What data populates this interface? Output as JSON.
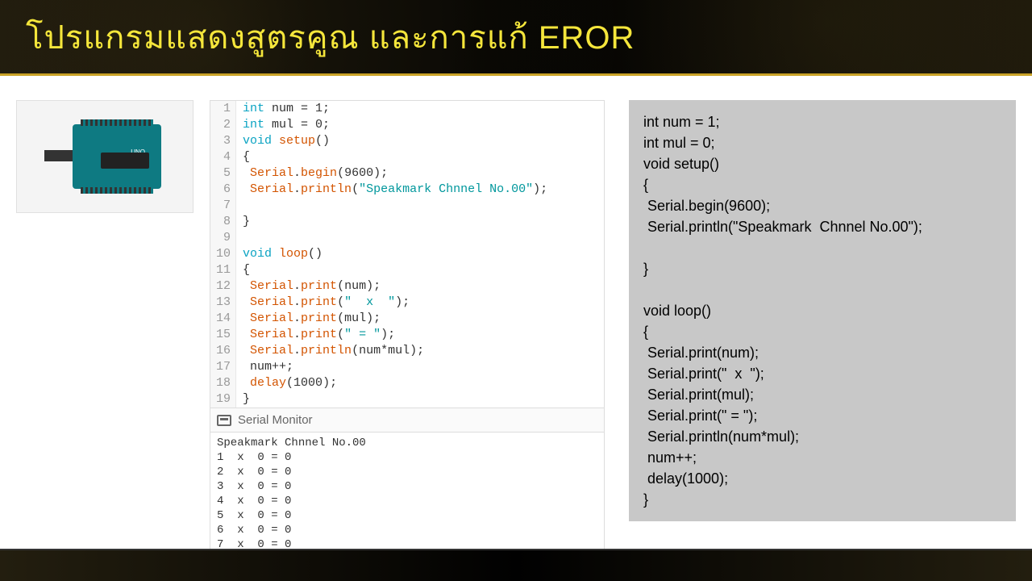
{
  "title": "โปรแกรมแสดงสูตรคูณ และการแก้ EROR",
  "arduino_label": "UNO",
  "editor": {
    "lines": [
      {
        "n": "1",
        "segs": [
          {
            "t": "int",
            "c": "kw"
          },
          {
            "t": " num = "
          },
          {
            "t": "1",
            "c": "num"
          },
          {
            "t": ";"
          }
        ]
      },
      {
        "n": "2",
        "segs": [
          {
            "t": "int",
            "c": "kw"
          },
          {
            "t": " mul = "
          },
          {
            "t": "0",
            "c": "num"
          },
          {
            "t": ";"
          }
        ]
      },
      {
        "n": "3",
        "segs": [
          {
            "t": "void",
            "c": "kw"
          },
          {
            "t": " "
          },
          {
            "t": "setup",
            "c": "fn"
          },
          {
            "t": "()"
          }
        ]
      },
      {
        "n": "4",
        "segs": [
          {
            "t": "{"
          }
        ]
      },
      {
        "n": "5",
        "segs": [
          {
            "t": " "
          },
          {
            "t": "Serial",
            "c": "fn"
          },
          {
            "t": "."
          },
          {
            "t": "begin",
            "c": "fn"
          },
          {
            "t": "("
          },
          {
            "t": "9600",
            "c": "num"
          },
          {
            "t": ");"
          }
        ]
      },
      {
        "n": "6",
        "segs": [
          {
            "t": " "
          },
          {
            "t": "Serial",
            "c": "fn"
          },
          {
            "t": "."
          },
          {
            "t": "println",
            "c": "fn"
          },
          {
            "t": "("
          },
          {
            "t": "\"Speakmark Chnnel No.00\"",
            "c": "str"
          },
          {
            "t": ");"
          }
        ]
      },
      {
        "n": "7",
        "segs": [
          {
            "t": " "
          }
        ]
      },
      {
        "n": "8",
        "segs": [
          {
            "t": "}"
          }
        ]
      },
      {
        "n": "9",
        "segs": [
          {
            "t": ""
          }
        ]
      },
      {
        "n": "10",
        "segs": [
          {
            "t": "void",
            "c": "kw"
          },
          {
            "t": " "
          },
          {
            "t": "loop",
            "c": "fn"
          },
          {
            "t": "()"
          }
        ]
      },
      {
        "n": "11",
        "segs": [
          {
            "t": "{"
          }
        ]
      },
      {
        "n": "12",
        "segs": [
          {
            "t": " "
          },
          {
            "t": "Serial",
            "c": "fn"
          },
          {
            "t": "."
          },
          {
            "t": "print",
            "c": "fn"
          },
          {
            "t": "(num);"
          }
        ]
      },
      {
        "n": "13",
        "segs": [
          {
            "t": " "
          },
          {
            "t": "Serial",
            "c": "fn"
          },
          {
            "t": "."
          },
          {
            "t": "print",
            "c": "fn"
          },
          {
            "t": "("
          },
          {
            "t": "\"  x  \"",
            "c": "str"
          },
          {
            "t": ");"
          }
        ]
      },
      {
        "n": "14",
        "segs": [
          {
            "t": " "
          },
          {
            "t": "Serial",
            "c": "fn"
          },
          {
            "t": "."
          },
          {
            "t": "print",
            "c": "fn"
          },
          {
            "t": "(mul);"
          }
        ]
      },
      {
        "n": "15",
        "segs": [
          {
            "t": " "
          },
          {
            "t": "Serial",
            "c": "fn"
          },
          {
            "t": "."
          },
          {
            "t": "print",
            "c": "fn"
          },
          {
            "t": "("
          },
          {
            "t": "\" = \"",
            "c": "str"
          },
          {
            "t": ");"
          }
        ]
      },
      {
        "n": "16",
        "segs": [
          {
            "t": " "
          },
          {
            "t": "Serial",
            "c": "fn"
          },
          {
            "t": "."
          },
          {
            "t": "println",
            "c": "fn"
          },
          {
            "t": "(num*mul);"
          }
        ]
      },
      {
        "n": "17",
        "segs": [
          {
            "t": " num++;"
          }
        ]
      },
      {
        "n": "18",
        "segs": [
          {
            "t": " "
          },
          {
            "t": "delay",
            "c": "fn"
          },
          {
            "t": "("
          },
          {
            "t": "1000",
            "c": "num"
          },
          {
            "t": ");"
          }
        ]
      },
      {
        "n": "19",
        "segs": [
          {
            "t": "}"
          }
        ]
      }
    ]
  },
  "serial_monitor_label": "Serial Monitor",
  "serial_output": "Speakmark Chnnel No.00\n1  x  0 = 0\n2  x  0 = 0\n3  x  0 = 0\n4  x  0 = 0\n5  x  0 = 0\n6  x  0 = 0\n7  x  0 = 0",
  "right_code": "int num = 1;\nint mul = 0;\nvoid setup()\n{\n Serial.begin(9600);\n Serial.println(\"Speakmark  Chnnel No.00\");\n\n}\n\nvoid loop()\n{\n Serial.print(num);\n Serial.print(\"  x  \");\n Serial.print(mul);\n Serial.print(\" = \");\n Serial.println(num*mul);\n num++;\n delay(1000);\n}"
}
